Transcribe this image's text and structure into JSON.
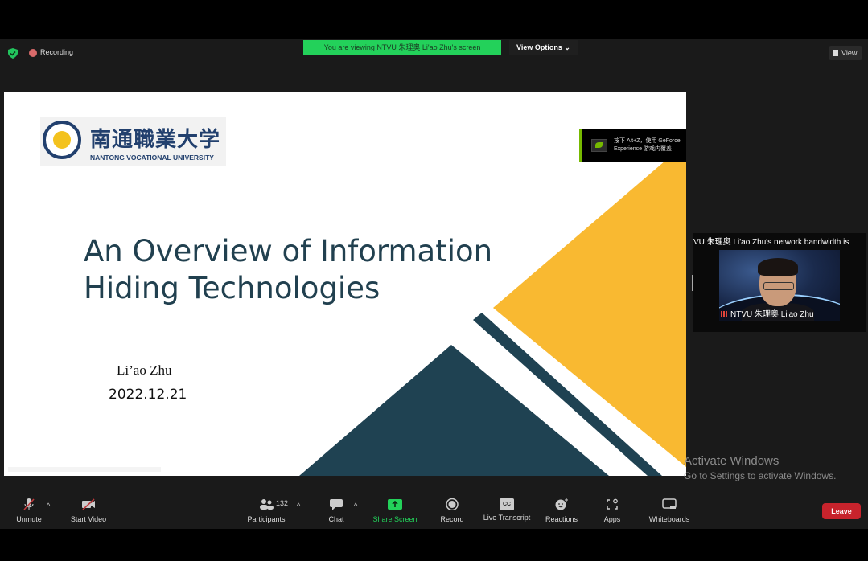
{
  "top_bar": {
    "security_icon": "shield-check-icon",
    "recording_label": "Recording",
    "viewing_banner": "You are viewing NTVU  朱理奥  Li'ao Zhu's screen",
    "view_options_label": "View Options ⌄",
    "view_label": "View"
  },
  "slide": {
    "logo_chinese": "南通職業大学",
    "logo_english": "NANTONG VOCATIONAL UNIVERSITY",
    "title_line1": "An Overview of Information",
    "title_line2": "Hiding Technologies",
    "author": "Li’ao Zhu",
    "date": "2022.12.21",
    "colors": {
      "accent_yellow": "#f9b931",
      "accent_dark": "#1f4252",
      "title_text": "#21404f"
    }
  },
  "geforce_overlay": {
    "line1": "按下 Alt+Z，使用 GeForce",
    "line2": "Experience 游戏内覆盖"
  },
  "participant_thumbnail": {
    "caption": "VU  朱理奥  Li'ao Zhu's network bandwidth is",
    "name": "NTVU  朱理奥   Li'ao Zhu"
  },
  "watermark": {
    "line1": "Activate Windows",
    "line2": "Go to Settings to activate Windows."
  },
  "toolbar": {
    "unmute_label": "Unmute",
    "start_video_label": "Start Video",
    "participants_label": "Participants",
    "participants_count": "132",
    "chat_label": "Chat",
    "share_screen_label": "Share Screen",
    "record_label": "Record",
    "live_transcript_label": "Live Transcript",
    "reactions_label": "Reactions",
    "apps_label": "Apps",
    "whiteboards_label": "Whiteboards",
    "leave_label": "Leave",
    "cc_text": "CC",
    "caret": "^",
    "share_color": "#23d15a",
    "leave_color": "#c7232c"
  }
}
